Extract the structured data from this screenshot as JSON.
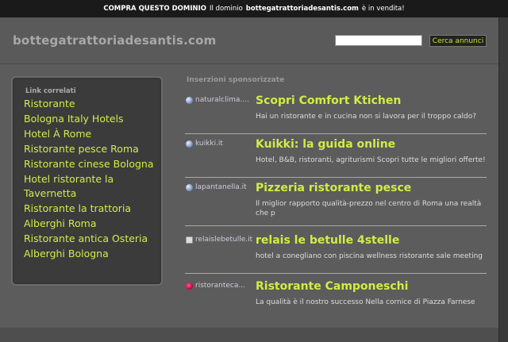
{
  "topbar": {
    "buy_domain": "COMPRA QUESTO DOMINIO",
    "text_before": "Il dominio",
    "domain": "bottegatrattoriadesantis.com",
    "text_after": "è in vendita!"
  },
  "header": {
    "site_title": "bottegatrattoriadesantis.com",
    "search_value": "",
    "search_button": "Cerca annunci"
  },
  "sidebar": {
    "title": "Link correlati",
    "items": [
      "Ristorante",
      "Bologna Italy Hotels",
      "Hotel À Rome",
      "Ristorante pesce Roma",
      "Ristorante cinese Bologna",
      "Hotel ristorante la Tavernetta",
      "Ristorante la trattoria",
      "Alberghi Roma",
      "Ristorante antica Osteria",
      "Alberghi Bologna"
    ]
  },
  "sponsored": {
    "title": "Inserzioni sponsorizzate",
    "listings": [
      {
        "domain": "naturalclima....",
        "headline": "Scopri Comfort Ktichen",
        "desc": "Hai un ristorante e in cucina non si lavora per il troppo caldo?",
        "icon": "globe-icon"
      },
      {
        "domain": "kuikki.it",
        "headline": "Kuikki: la guida online",
        "desc": "Hotel, B&B, ristoranti, agriturismi Scopri tutte le migliori offerte!",
        "icon": "globe-icon"
      },
      {
        "domain": "lapantanella.it",
        "headline": "Pizzeria ristorante pesce",
        "desc": "Il miglior rapporto qualità-prezzo nel centro di Roma una realtà che p",
        "icon": "globe-icon"
      },
      {
        "domain": "relaislebetulle.it",
        "headline": "relais le betulle 4stelle",
        "desc": "hotel a conegliano con piscina wellness ristorante sale meeting",
        "icon": "page-icon"
      },
      {
        "domain": "ristoranteca...",
        "headline": "Ristorante Camponeschi",
        "desc": "La qualità è il nostro successo Nella cornice di Piazza Farnese",
        "icon": "site-logo-icon"
      }
    ]
  }
}
